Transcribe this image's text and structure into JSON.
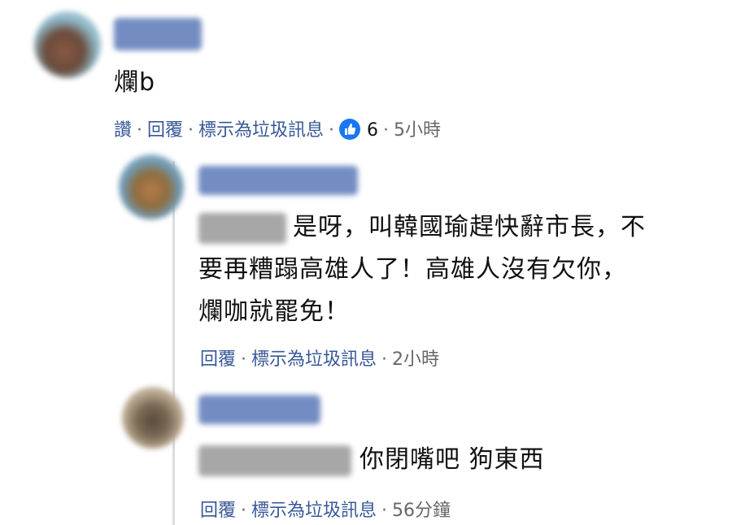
{
  "comments": [
    {
      "text": "爛b",
      "actions": {
        "like": "讚",
        "reply": "回覆",
        "spam": "標示為垃圾訊息",
        "like_count": "6",
        "time": "5小時"
      }
    },
    {
      "line1": "是呀，叫韓國瑜趕快辭市長，不",
      "line2": "要再糟蹋高雄人了！高雄人沒有欠你，",
      "line3": "爛咖就罷免！",
      "actions": {
        "reply": "回覆",
        "spam": "標示為垃圾訊息",
        "time": "2小時"
      }
    },
    {
      "text": "你閉嘴吧 狗東西",
      "actions": {
        "reply": "回覆",
        "spam": "標示為垃圾訊息",
        "time": "56分鐘"
      }
    }
  ],
  "separator": "·",
  "icons": {
    "like": "thumbs-up-icon"
  },
  "colors": {
    "link": "#385898",
    "meta": "#65676b",
    "like_badge": "#1877f2"
  }
}
